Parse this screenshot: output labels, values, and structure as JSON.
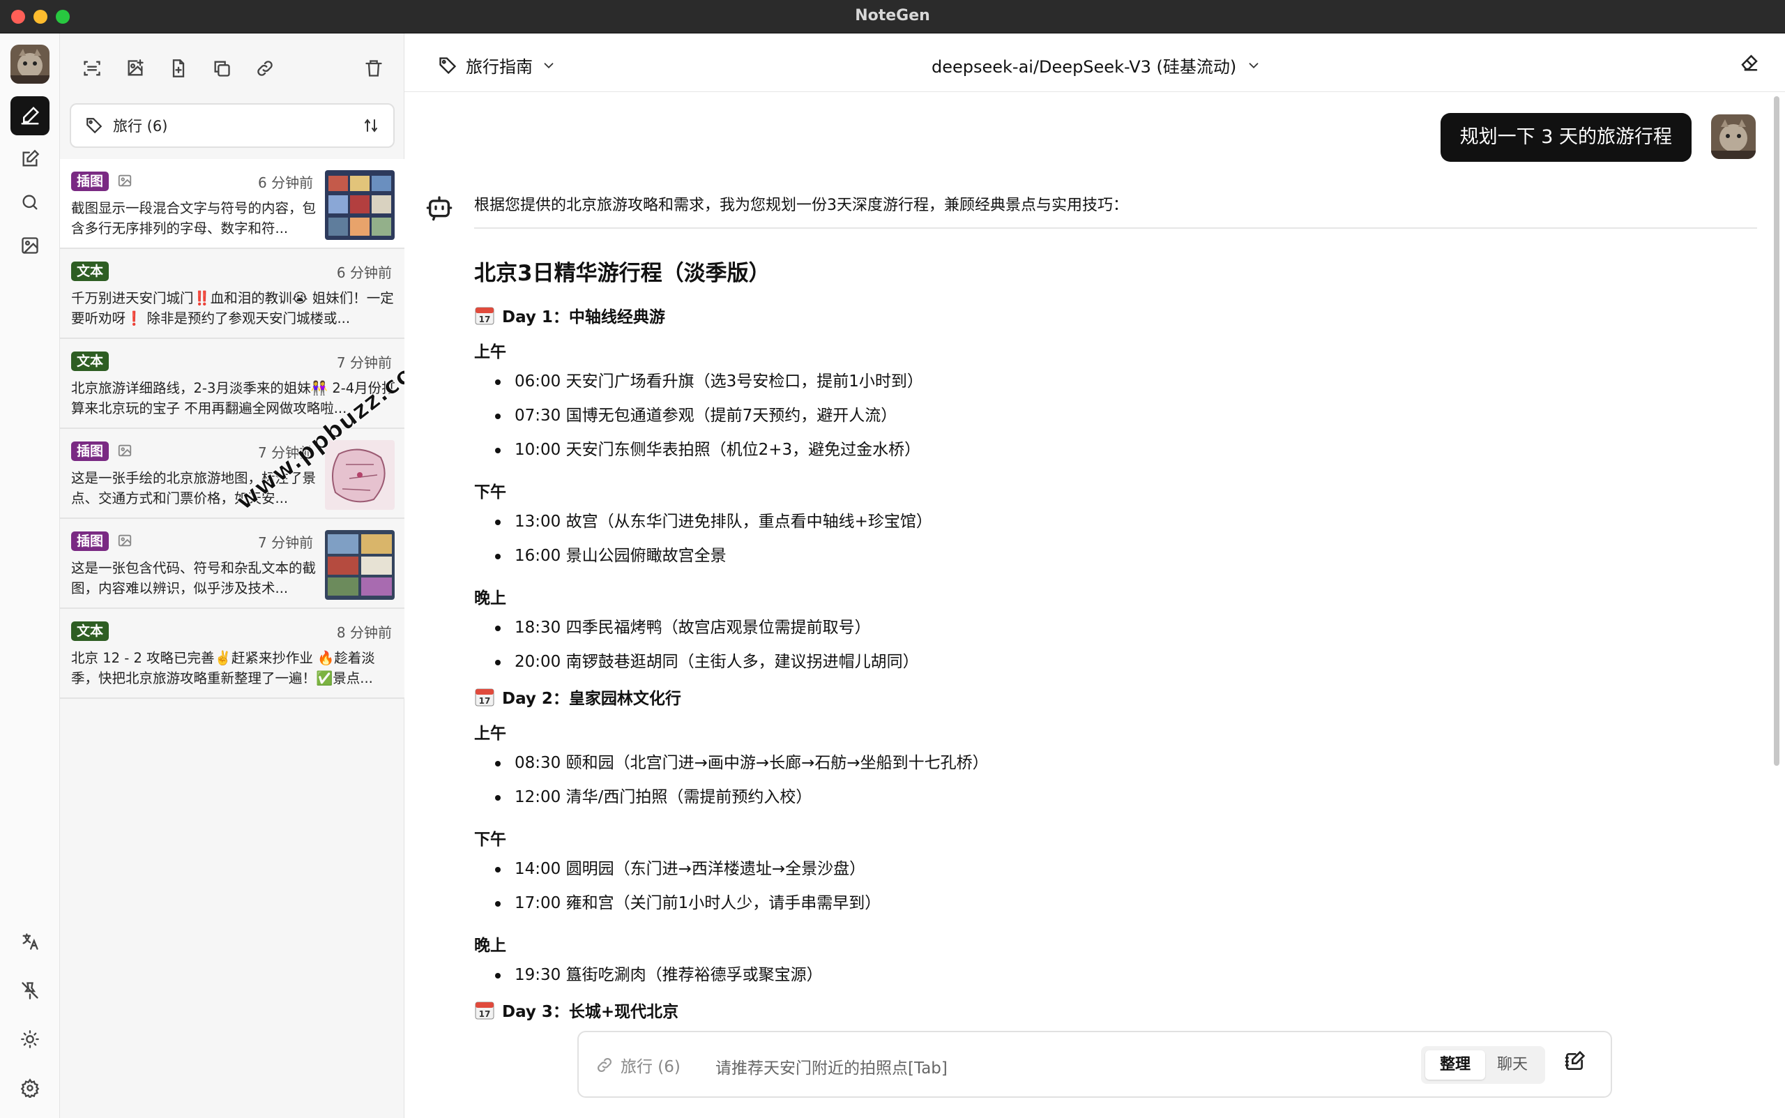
{
  "window": {
    "title": "NoteGen"
  },
  "notes_panel": {
    "tag_filter": "旅行 (6)",
    "items": [
      {
        "type": "插图",
        "kind": "image",
        "time": "6 分钟前",
        "desc": "截图显示一段混合文字与符号的内容，包含多行无序排列的字母、数字和符..."
      },
      {
        "type": "文本",
        "kind": "text",
        "time": "6 分钟前",
        "desc": "千万别进天安门城门‼️血和泪的教训😭 姐妹们！一定要听劝呀❗️ 除非是预约了参观天安门城楼或..."
      },
      {
        "type": "文本",
        "kind": "text",
        "time": "7 分钟前",
        "desc": "北京旅游详细路线，2-3月淡季来的姐妹👭 2-4月份打算来北京玩的宝子 不用再翻遍全网做攻略啦..."
      },
      {
        "type": "插图",
        "kind": "image",
        "time": "7 分钟前",
        "desc": "这是一张手绘的北京旅游地图，标注了景点、交通方式和门票价格，如天安..."
      },
      {
        "type": "插图",
        "kind": "image",
        "time": "7 分钟前",
        "desc": "这是一张包含代码、符号和杂乱文本的截图，内容难以辨识，似乎涉及技术..."
      },
      {
        "type": "文本",
        "kind": "text",
        "time": "8 分钟前",
        "desc": "北京 12 - 2 攻略已完善✌️赶紧来抄作业 🔥趁着淡季，快把北京旅游攻略重新整理了一遍！✅景点..."
      }
    ]
  },
  "header": {
    "tag": "旅行指南",
    "model": "deepseek-ai/DeepSeek-V3 (硅基流动)"
  },
  "chat": {
    "user_message": "规划一下 3 天的旅游行程",
    "intro": "根据您提供的北京旅游攻略和需求，我为您规划一份3天深度游行程，兼顾经典景点与实用技巧：",
    "title": "北京3日精华游行程（淡季版）",
    "day1": {
      "title": "Day 1：中轴线经典游",
      "morning_label": "上午",
      "morning": [
        "06:00 天安门广场看升旗（选3号安检口，提前1小时到）",
        "07:30 国博无包通道参观（提前7天预约，避开人流）",
        "10:00 天安门东侧华表拍照（机位2+3，避免过金水桥）"
      ],
      "afternoon_label": "下午",
      "afternoon": [
        "13:00 故宫（从东华门进免排队，重点看中轴线+珍宝馆）",
        "16:00 景山公园俯瞰故宫全景"
      ],
      "evening_label": "晚上",
      "evening": [
        "18:30 四季民福烤鸭（故宫店观景位需提前取号）",
        "20:00 南锣鼓巷逛胡同（主街人多，建议拐进帽儿胡同）"
      ]
    },
    "day2": {
      "title": "Day 2：皇家园林文化行",
      "morning_label": "上午",
      "morning": [
        "08:30 颐和园（北宫门进→画中游→长廊→石舫→坐船到十七孔桥）",
        "12:00 清华/西门拍照（需提前预约入校）"
      ],
      "afternoon_label": "下午",
      "afternoon": [
        "14:00 圆明园（东门进→西洋楼遗址→全景沙盘）",
        "17:00 雍和宫（关门前1小时人少，请手串需早到）"
      ],
      "evening_label": "晚上",
      "evening": [
        "19:30 簋街吃涮肉（推荐裕德孚或聚宝源）"
      ]
    },
    "day3": {
      "title": "Day 3：长城+现代北京"
    }
  },
  "input": {
    "tag": "旅行 (6)",
    "placeholder": "请推荐天安门附近的拍照点[Tab]",
    "mode_active": "整理",
    "mode_other": "聊天"
  },
  "watermark": "www.ppbuzz.com"
}
